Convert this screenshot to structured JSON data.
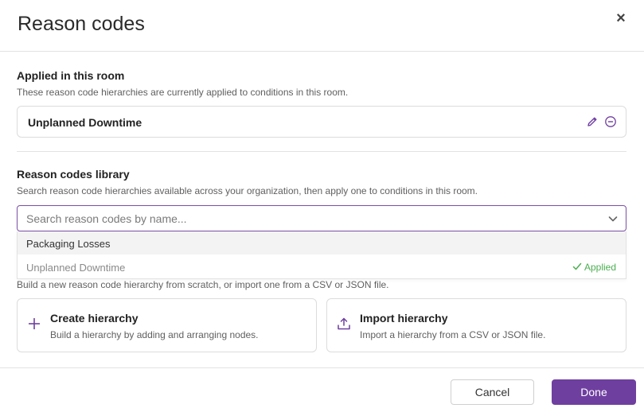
{
  "modal": {
    "title": "Reason codes",
    "close_label": "×"
  },
  "applied_section": {
    "title": "Applied in this room",
    "subtitle": "These reason code hierarchies are currently applied to conditions in this room.",
    "items": [
      {
        "name": "Unplanned Downtime"
      }
    ]
  },
  "library_section": {
    "title": "Reason codes library",
    "subtitle": "Search reason code hierarchies available across your organization, then apply one to conditions in this room.",
    "search": {
      "value": "",
      "placeholder": "Search reason codes by name..."
    },
    "dropdown_options": [
      {
        "label": "Packaging Losses",
        "status": ""
      },
      {
        "label": "Unplanned Downtime",
        "status": "Applied"
      }
    ],
    "build_hint": "Build a new reason code hierarchy from scratch, or import one from a CSV or JSON file."
  },
  "actions": {
    "create": {
      "title": "Create hierarchy",
      "description": "Build a hierarchy by adding and arranging nodes.",
      "icon": "plus-icon"
    },
    "import": {
      "title": "Import hierarchy",
      "description": "Import a hierarchy from a CSV or JSON file.",
      "icon": "upload-icon"
    }
  },
  "footer": {
    "cancel_label": "Cancel",
    "done_label": "Done"
  },
  "colors": {
    "accent": "#6f3fa0",
    "applied_green": "#4caf50"
  }
}
